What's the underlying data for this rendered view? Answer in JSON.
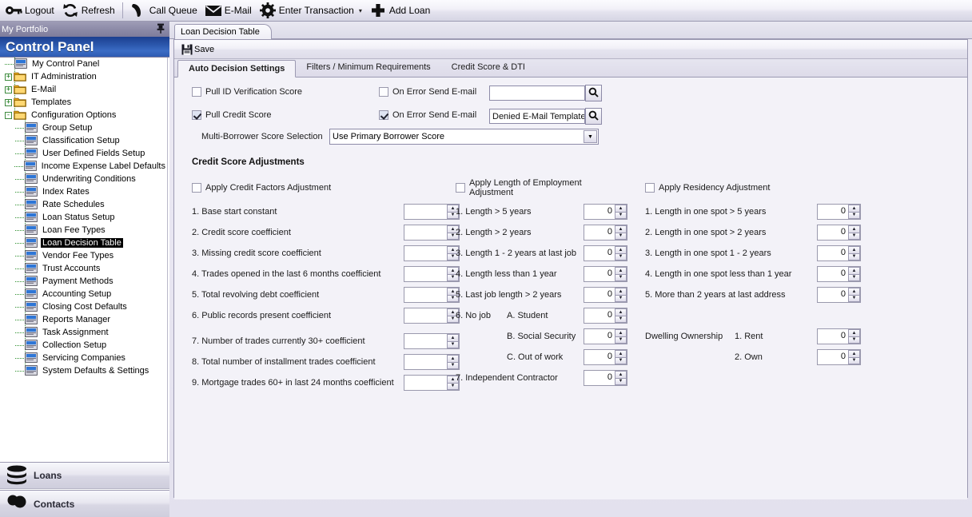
{
  "toolbar": {
    "items": [
      {
        "icon": "key-icon",
        "label": "Logout"
      },
      {
        "icon": "refresh-icon",
        "label": "Refresh"
      },
      {
        "icon": "phone-icon",
        "label": "Call Queue"
      },
      {
        "icon": "envelope-icon",
        "label": "E-Mail"
      },
      {
        "icon": "gear-icon",
        "label": "Enter Transaction",
        "caret": "▾"
      },
      {
        "icon": "plus-icon",
        "label": "Add Loan"
      }
    ]
  },
  "sidebar": {
    "portfolio_title": "My Portfolio",
    "pin_icon": "pin-icon",
    "header": "Control Panel",
    "tree": [
      {
        "label": "My Control Panel",
        "level": 1,
        "icon": "document-icon",
        "expander": "",
        "selected": false
      },
      {
        "label": "IT Administration",
        "level": 1,
        "icon": "folder-icon",
        "expander": "+",
        "selected": false
      },
      {
        "label": "E-Mail",
        "level": 1,
        "icon": "folder-icon",
        "expander": "+",
        "selected": false
      },
      {
        "label": "Templates",
        "level": 1,
        "icon": "folder-icon",
        "expander": "+",
        "selected": false
      },
      {
        "label": "Configuration Options",
        "level": 1,
        "icon": "folder-icon",
        "expander": "-",
        "selected": false
      },
      {
        "label": "Group Setup",
        "level": 2,
        "icon": "document-icon",
        "expander": "",
        "selected": false
      },
      {
        "label": "Classification Setup",
        "level": 2,
        "icon": "document-icon",
        "expander": "",
        "selected": false
      },
      {
        "label": "User Defined Fields Setup",
        "level": 2,
        "icon": "document-icon",
        "expander": "",
        "selected": false
      },
      {
        "label": "Income Expense Label Defaults",
        "level": 2,
        "icon": "document-icon",
        "expander": "",
        "selected": false
      },
      {
        "label": "Underwriting Conditions",
        "level": 2,
        "icon": "document-icon",
        "expander": "",
        "selected": false
      },
      {
        "label": "Index Rates",
        "level": 2,
        "icon": "document-icon",
        "expander": "",
        "selected": false
      },
      {
        "label": "Rate Schedules",
        "level": 2,
        "icon": "document-icon",
        "expander": "",
        "selected": false
      },
      {
        "label": "Loan Status Setup",
        "level": 2,
        "icon": "document-icon",
        "expander": "",
        "selected": false
      },
      {
        "label": "Loan Fee Types",
        "level": 2,
        "icon": "document-icon",
        "expander": "",
        "selected": false
      },
      {
        "label": "Loan Decision Table",
        "level": 2,
        "icon": "document-icon",
        "expander": "",
        "selected": true
      },
      {
        "label": "Vendor Fee Types",
        "level": 2,
        "icon": "document-icon",
        "expander": "",
        "selected": false
      },
      {
        "label": "Trust Accounts",
        "level": 2,
        "icon": "document-icon",
        "expander": "",
        "selected": false
      },
      {
        "label": "Payment Methods",
        "level": 2,
        "icon": "document-icon",
        "expander": "",
        "selected": false
      },
      {
        "label": "Accounting Setup",
        "level": 2,
        "icon": "document-icon",
        "expander": "",
        "selected": false
      },
      {
        "label": "Closing Cost Defaults",
        "level": 2,
        "icon": "document-icon",
        "expander": "",
        "selected": false
      },
      {
        "label": "Reports Manager",
        "level": 2,
        "icon": "document-icon",
        "expander": "",
        "selected": false
      },
      {
        "label": "Task Assignment",
        "level": 2,
        "icon": "document-icon",
        "expander": "",
        "selected": false
      },
      {
        "label": "Collection Setup",
        "level": 2,
        "icon": "document-icon",
        "expander": "",
        "selected": false
      },
      {
        "label": "Servicing Companies",
        "level": 2,
        "icon": "document-icon",
        "expander": "",
        "selected": false
      },
      {
        "label": "System Defaults & Settings",
        "level": 2,
        "icon": "document-icon",
        "expander": "",
        "selected": false
      }
    ],
    "nav": [
      {
        "label": "Loans",
        "icon": "database-icon"
      },
      {
        "label": "Contacts",
        "icon": "contacts-icon"
      }
    ]
  },
  "document": {
    "tab_label": "Loan Decision Table",
    "command_bar": {
      "save_label": "Save",
      "save_icon": "save-disk-icon"
    },
    "tabs": [
      {
        "label": "Auto Decision Settings",
        "active": true
      },
      {
        "label": "Filters / Minimum Requirements",
        "active": false
      },
      {
        "label": "Credit Score & DTI",
        "active": false
      }
    ]
  },
  "auto_decision": {
    "pull_id_verification": {
      "label": "Pull ID Verification Score",
      "checked": false
    },
    "pull_credit_score": {
      "label": "Pull Credit Score",
      "checked": true
    },
    "on_error_row1": {
      "label": "On Error Send E-mail",
      "checked": false,
      "value": "",
      "placeholder": "",
      "search_icon": "magnifier-icon"
    },
    "on_error_row2": {
      "label": "On Error Send E-mail",
      "checked": true,
      "value": "Denied E-Mail Template",
      "placeholder": "",
      "search_icon": "magnifier-icon"
    },
    "multi_borrower": {
      "label": "Multi-Borrower Score Selection",
      "value": "Use Primary Borrower Score",
      "arrow_icon": "chevron-down-icon"
    },
    "section_title": "Credit Score Adjustments",
    "columns": [
      {
        "id": "credit-factors",
        "checkbox_label": "Apply Credit Factors Adjustment",
        "checked": false,
        "rows": [
          {
            "label": "1. Base start constant",
            "value": ""
          },
          {
            "label": "2. Credit score coefficient",
            "value": ""
          },
          {
            "label": "3. Missing credit score coefficient",
            "value": ""
          },
          {
            "label": "4. Trades opened in the last 6 months coefficient",
            "value": ""
          },
          {
            "label": "5. Total revolving debt coefficient",
            "value": ""
          },
          {
            "label": "6. Public records present coefficient",
            "value": ""
          },
          {
            "label": "7. Number of trades currently 30+ coefficient",
            "value": ""
          },
          {
            "label": "8. Total number of installment trades coefficient",
            "value": ""
          },
          {
            "label": "9. Mortgage trades 60+ in last 24 months coefficient",
            "value": ""
          }
        ]
      },
      {
        "id": "length-of-employment",
        "checkbox_label": "Apply Length of Employment Adjustment",
        "checked": false,
        "rows": [
          {
            "label": "1. Length > 5 years",
            "value": "0"
          },
          {
            "label": "2. Length > 2 years",
            "value": "0"
          },
          {
            "label": "3. Length 1 - 2 years at last job",
            "value": "0"
          },
          {
            "label": "4. Length less than 1 year",
            "value": "0"
          },
          {
            "label": "5. Last job length > 2 years",
            "value": "0"
          },
          {
            "label": "6. No job",
            "sublabel": "A. Student",
            "value": "0"
          },
          {
            "label": "",
            "sublabel": "B. Social Security",
            "value": "0"
          },
          {
            "label": "",
            "sublabel": "C. Out of work",
            "value": "0"
          },
          {
            "label": "7. Independent Contractor",
            "value": "0"
          }
        ]
      },
      {
        "id": "residency",
        "checkbox_label": "Apply Residency Adjustment",
        "checked": false,
        "rows": [
          {
            "label": "1. Length in one spot > 5 years",
            "value": "0"
          },
          {
            "label": "2. Length in one spot > 2 years",
            "value": "0"
          },
          {
            "label": "3. Length in one spot 1 - 2 years",
            "value": "0"
          },
          {
            "label": "4. Length in one spot less than 1 year",
            "value": "0"
          },
          {
            "label": "5. More than 2 years at last address",
            "value": "0"
          }
        ],
        "dwelling": {
          "label": "Dwelling Ownership",
          "rows": [
            {
              "label": "1. Rent",
              "value": "0"
            },
            {
              "label": "2. Own",
              "value": "0"
            }
          ]
        }
      }
    ]
  },
  "colors": {
    "header_blue_dark": "#1b3f8f",
    "header_blue_light": "#3b6cc4",
    "panel_bg": "#f3f2f8",
    "border": "#9c9ab2",
    "tree_line_green": "#2f8f2f",
    "folder_yellow": "#f2c14a",
    "selection_black": "#000000"
  }
}
